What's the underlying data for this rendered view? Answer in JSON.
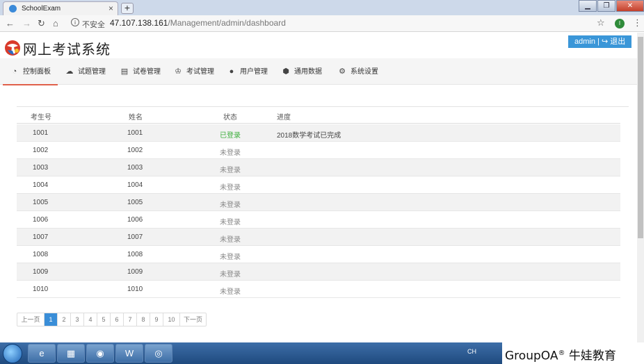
{
  "browser": {
    "tab_title": "SchoolExam",
    "tab_close": "×",
    "new_tab": "+",
    "security_label": "不安全",
    "url_host": "47.107.138.161",
    "url_path": "/Management/admin/dashboard",
    "extension_letter": "I",
    "window_buttons": [
      "▁",
      "❐",
      "✕"
    ]
  },
  "app": {
    "title": "网上考试系统",
    "user_name": "admin",
    "logout_label": "退出"
  },
  "menu": [
    {
      "label": "控制面板",
      "icon": "dashboard-icon",
      "glyph": "◔"
    },
    {
      "label": "试题管理",
      "icon": "cloud-icon",
      "glyph": "☁"
    },
    {
      "label": "试卷管理",
      "icon": "document-icon",
      "glyph": "▤"
    },
    {
      "label": "考试管理",
      "icon": "trophy-icon",
      "glyph": "♔"
    },
    {
      "label": "用户管理",
      "icon": "user-icon",
      "glyph": "●"
    },
    {
      "label": "通用数据",
      "icon": "cubes-icon",
      "glyph": "⬢"
    },
    {
      "label": "系统设置",
      "icon": "gear-icon",
      "glyph": "⚙"
    }
  ],
  "table": {
    "headers": [
      "考生号",
      "姓名",
      "状态",
      "进度"
    ],
    "rows": [
      {
        "id": "1001",
        "name": "1001",
        "status": "已登录",
        "progress": "2018数学考试已完成",
        "online": true
      },
      {
        "id": "1002",
        "name": "1002",
        "status": "未登录",
        "progress": "",
        "online": false
      },
      {
        "id": "1003",
        "name": "1003",
        "status": "未登录",
        "progress": "",
        "online": false
      },
      {
        "id": "1004",
        "name": "1004",
        "status": "未登录",
        "progress": "",
        "online": false
      },
      {
        "id": "1005",
        "name": "1005",
        "status": "未登录",
        "progress": "",
        "online": false
      },
      {
        "id": "1006",
        "name": "1006",
        "status": "未登录",
        "progress": "",
        "online": false
      },
      {
        "id": "1007",
        "name": "1007",
        "status": "未登录",
        "progress": "",
        "online": false
      },
      {
        "id": "1008",
        "name": "1008",
        "status": "未登录",
        "progress": "",
        "online": false
      },
      {
        "id": "1009",
        "name": "1009",
        "status": "未登录",
        "progress": "",
        "online": false
      },
      {
        "id": "1010",
        "name": "1010",
        "status": "未登录",
        "progress": "",
        "online": false
      }
    ]
  },
  "pager": {
    "prev": "上一页",
    "pages": [
      "1",
      "2",
      "3",
      "4",
      "5",
      "6",
      "7",
      "8",
      "9",
      "10"
    ],
    "next": "下一页",
    "current": "1"
  },
  "taskbar": {
    "tray_text": "CH",
    "watermark": "GroupOA",
    "watermark_mark": "®",
    "watermark_suffix": "牛娃教育"
  },
  "colors": {
    "accent": "#3a8ed8",
    "active_underline": "#e0604a",
    "online_status": "#3cae3c"
  }
}
